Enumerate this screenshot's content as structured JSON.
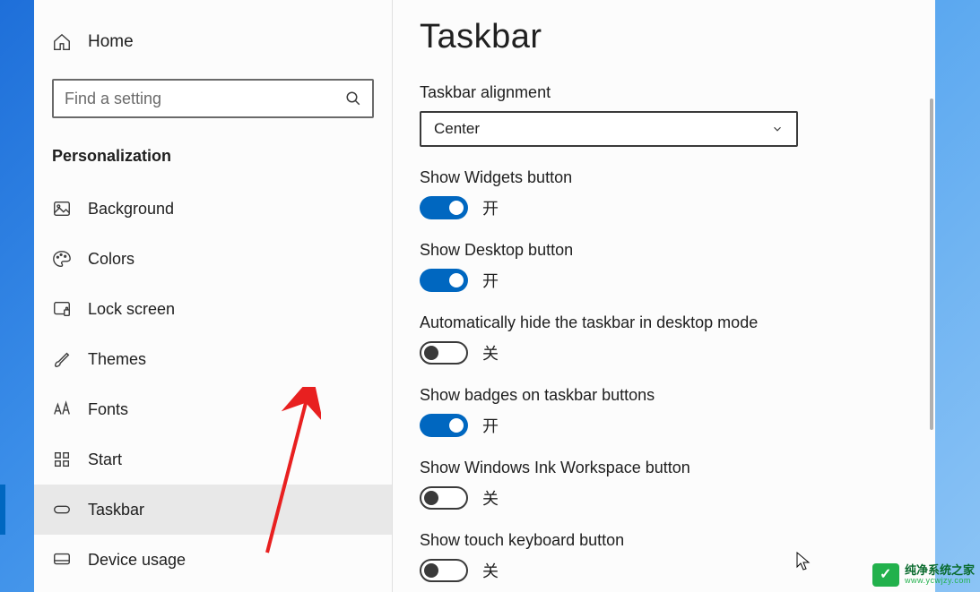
{
  "sidebar": {
    "home": "Home",
    "search_placeholder": "Find a setting",
    "category": "Personalization",
    "items": [
      {
        "label": "Background"
      },
      {
        "label": "Colors"
      },
      {
        "label": "Lock screen"
      },
      {
        "label": "Themes"
      },
      {
        "label": "Fonts"
      },
      {
        "label": "Start"
      },
      {
        "label": "Taskbar"
      },
      {
        "label": "Device usage"
      }
    ]
  },
  "main": {
    "title": "Taskbar",
    "alignment": {
      "label": "Taskbar alignment",
      "value": "Center"
    },
    "settings": [
      {
        "label": "Show Widgets button",
        "on": true,
        "state": "开"
      },
      {
        "label": "Show Desktop button",
        "on": true,
        "state": "开"
      },
      {
        "label": "Automatically hide the taskbar in desktop mode",
        "on": false,
        "state": "关"
      },
      {
        "label": "Show badges on taskbar buttons",
        "on": true,
        "state": "开"
      },
      {
        "label": "Show Windows Ink Workspace button",
        "on": false,
        "state": "关"
      },
      {
        "label": "Show touch keyboard button",
        "on": false,
        "state": "关"
      }
    ]
  },
  "watermark": {
    "title": "纯净系统之家",
    "url": "www.ycwjzy.com"
  }
}
